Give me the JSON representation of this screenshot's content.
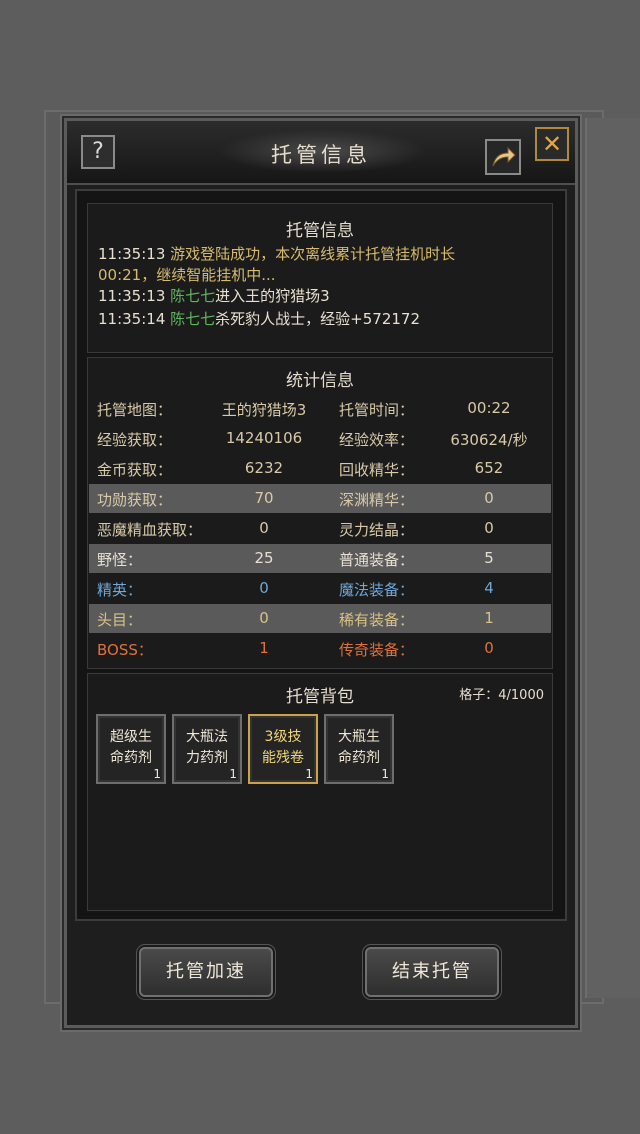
{
  "dialog": {
    "title": "托管信息",
    "help_glyph": "?",
    "close_glyph": "✕"
  },
  "log": {
    "title": "托管信息",
    "entries": [
      {
        "time": "11:35:13",
        "segments": [
          {
            "text": "游戏登陆成功，本次离线累计托管挂机时长",
            "color": "gold"
          }
        ],
        "line2": "00:21，继续智能挂机中..."
      },
      {
        "time": "11:35:13",
        "segments": [
          {
            "text": "陈七七",
            "color": "green"
          },
          {
            "text": "进入王的狩猎场3",
            "color": "white"
          }
        ]
      },
      {
        "time": "11:35:14",
        "segments": [
          {
            "text": "陈七七",
            "color": "green"
          },
          {
            "text": "杀死豹人战士，经验+572172",
            "color": "white"
          }
        ]
      }
    ]
  },
  "stats": {
    "title": "统计信息",
    "rows": [
      {
        "l1": "托管地图：",
        "v1": "王的狩猎场3",
        "l2": "托管时间：",
        "v2": "00:22",
        "highlight": false,
        "color": "#d8c9a8"
      },
      {
        "l1": "经验获取：",
        "v1": "14240106",
        "l2": "经验效率：",
        "v2": "630624/秒",
        "highlight": false,
        "color": "#d8c9a8"
      },
      {
        "l1": "金币获取：",
        "v1": "6232",
        "l2": "回收精华：",
        "v2": "652",
        "highlight": false,
        "color": "#d8c9a8"
      },
      {
        "l1": "功勋获取：",
        "v1": "70",
        "l2": "深渊精华：",
        "v2": "0",
        "highlight": true,
        "color": "#d8c9a8"
      },
      {
        "l1": "恶魔精血获取：",
        "v1": "0",
        "l2": "灵力结晶：",
        "v2": "0",
        "highlight": false,
        "color": "#d8c9a8"
      },
      {
        "l1": "野怪：",
        "v1": "25",
        "l2": "普通装备：",
        "v2": "5",
        "highlight": true,
        "color": "#e6e0d2"
      },
      {
        "l1": "精英：",
        "v1": "0",
        "l2": "魔法装备：",
        "v2": "4",
        "highlight": false,
        "color": "#6fa6d6"
      },
      {
        "l1": "头目：",
        "v1": "0",
        "l2": "稀有装备：",
        "v2": "1",
        "highlight": true,
        "color": "#d9c286"
      },
      {
        "l1": "BOSS：",
        "v1": "1",
        "l2": "传奇装备：",
        "v2": "0",
        "highlight": false,
        "color": "#e0713a"
      }
    ]
  },
  "bag": {
    "title": "托管背包",
    "capacity_label": "格子：4/1000",
    "items": [
      {
        "line1": "超级生",
        "line2": "命药剂",
        "count": "1",
        "selected": false
      },
      {
        "line1": "大瓶法",
        "line2": "力药剂",
        "count": "1",
        "selected": false
      },
      {
        "line1": "3级技",
        "line2": "能残卷",
        "count": "1",
        "selected": true
      },
      {
        "line1": "大瓶生",
        "line2": "命药剂",
        "count": "1",
        "selected": false
      }
    ]
  },
  "buttons": {
    "speed_up": "托管加速",
    "end": "结束托管"
  },
  "colors": {
    "gold": "#d6bb6d",
    "green": "#5fb65f",
    "white": "#e8e0d0"
  }
}
